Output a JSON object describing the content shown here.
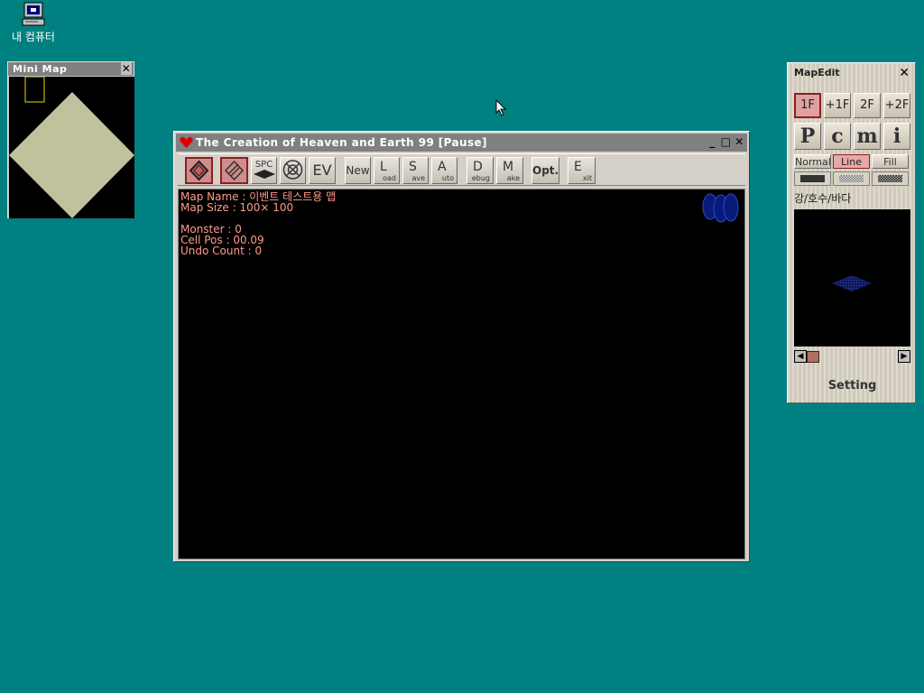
{
  "desktop": {
    "icon_label": "내 컴퓨터"
  },
  "minimap": {
    "title": "Mini Map",
    "close": "✕"
  },
  "main_window": {
    "title": "The Creation of Heaven and Earth 99 [Pause]",
    "controls": {
      "minimize": "_",
      "maximize": "□",
      "close": "✕"
    },
    "toolbar": {
      "spc": "SPC",
      "ev": "EV",
      "new": "New",
      "load_big": "L",
      "load_small": "oad",
      "save_big": "S",
      "save_small": "ave",
      "auto_big": "A",
      "auto_small": "uto",
      "debug_big": "D",
      "debug_small": "ebug",
      "make_big": "M",
      "make_small": "ake",
      "opt": "Opt.",
      "exit_big": "E",
      "exit_small": "xit"
    },
    "info": {
      "map_name": "Map Name : 이벤트 테스트용 맵",
      "map_size": "Map Size : 100×  100",
      "monster": "Monster : 0",
      "cell_pos": "Cell Pos : 00.09",
      "undo_count": "Undo Count : 0"
    }
  },
  "mapedit": {
    "title": "MapEdit",
    "close": "✕",
    "floors": [
      "1F",
      "+1F",
      "2F",
      "+2F"
    ],
    "selected_floor": "1F",
    "types": [
      "P",
      "c",
      "m",
      "i"
    ],
    "modes": [
      "Normal",
      "Line",
      "Fill"
    ],
    "selected_mode": "Line",
    "layer_label": "강/호수/바다",
    "scroll_left": "◀",
    "scroll_right": "▶",
    "setting": "Setting"
  },
  "colors": {
    "desktop": "#008080",
    "info_text": "#ff9a8a",
    "selected_red": "#8a2020",
    "map_diamond": "#c2c19e"
  }
}
